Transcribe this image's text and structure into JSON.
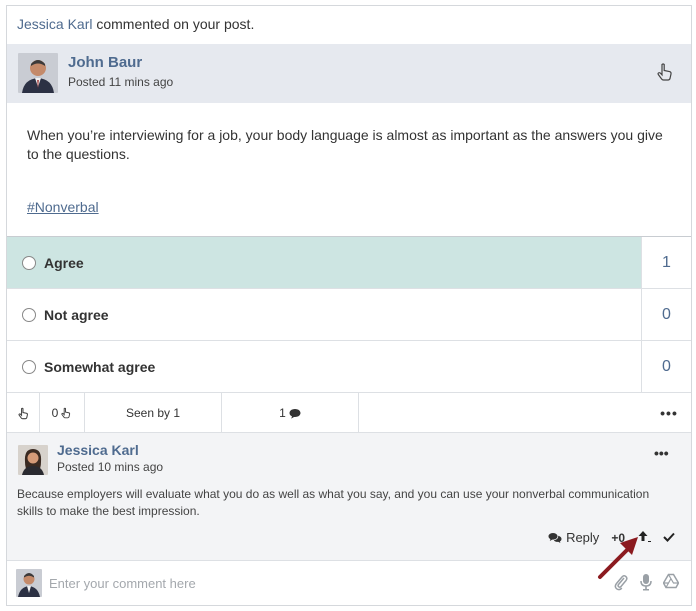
{
  "notification": {
    "actor": "Jessica Karl",
    "text": " commented on your post."
  },
  "post": {
    "author": "John Baur",
    "posted": "Posted 11 mins ago",
    "body": "When you’re interviewing for a job, your body language is almost as important as the answers you give to the questions.",
    "hashtag": "#Nonverbal"
  },
  "poll": {
    "options": [
      {
        "label": "Agree",
        "count": "1",
        "selected": true
      },
      {
        "label": "Not agree",
        "count": "0",
        "selected": false
      },
      {
        "label": "Somewhat agree",
        "count": "0",
        "selected": false
      }
    ]
  },
  "stats": {
    "likes": "0",
    "seen_by": "Seen by 1",
    "comments": "1",
    "more": "•••"
  },
  "comment": {
    "author": "Jessica Karl",
    "posted": "Posted 10 mins ago",
    "text": "Because employers will evaluate what you do as well as what you say, and you can use your nonverbal communication skills to make the best impression.",
    "reply_label": "Reply",
    "score": "+0",
    "more": "•••"
  },
  "compose": {
    "placeholder": "Enter your comment here"
  },
  "icons": {
    "like": "hand-pointer-icon",
    "comment": "speech-bubble-icon",
    "upvote": "arrow-up-icon",
    "accept": "check-icon",
    "attach": "paperclip-icon",
    "mic": "microphone-icon",
    "drive": "drive-icon"
  },
  "colors": {
    "accent": "#4f6b8f",
    "selected_row": "#cde5e2",
    "header_bg": "#e6e9ef",
    "arrow": "#8b1a1f"
  }
}
